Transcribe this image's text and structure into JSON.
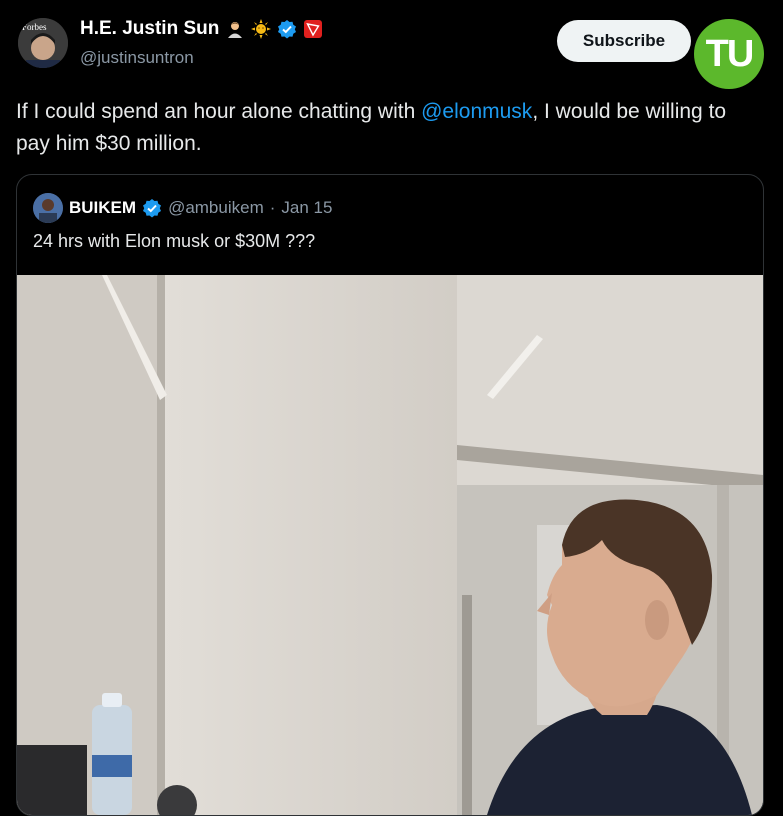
{
  "author": {
    "display_name": "H.E. Justin Sun",
    "handle": "@justinsuntron",
    "avatar_label": "Forbes",
    "badges": [
      "person-emoji",
      "sun-emoji",
      "verified-icon",
      "tron-icon"
    ]
  },
  "actions": {
    "subscribe_label": "Subscribe"
  },
  "logo": {
    "text": "TU",
    "color": "#5cb82c"
  },
  "tweet": {
    "text_before": "If I could spend an hour alone chatting with ",
    "mention": "@elonmusk",
    "text_after": ", I would be willing to pay him $30 million."
  },
  "quoted": {
    "display_name": "BUIKEM",
    "handle": "@ambuikem",
    "separator": "·",
    "date": "Jan 15",
    "text": "24 hrs with Elon musk or $30M ???",
    "image_icon": "photo-office-man"
  },
  "colors": {
    "link": "#1d9bf0",
    "verified": "#1d9bf0",
    "background": "#000000"
  }
}
